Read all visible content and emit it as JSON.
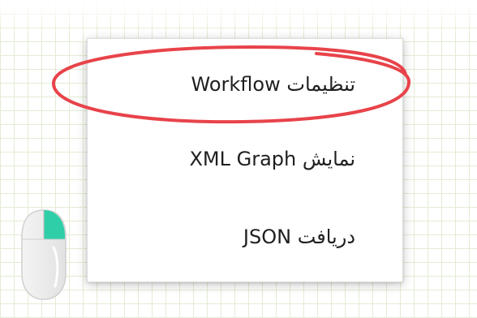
{
  "context_menu": {
    "items": [
      {
        "label": "تنظیمات Workflow",
        "highlighted": true
      },
      {
        "label": "نمایش XML Graph",
        "highlighted": false
      },
      {
        "label": "دریافت JSON",
        "highlighted": false
      }
    ]
  },
  "annotation": {
    "highlight_color": "#e8434a"
  },
  "mouse": {
    "icon": "mouse-right-click-icon",
    "accent_color": "#2ecfa8"
  },
  "canvas": {
    "grid_color": "#e3ecd4"
  }
}
